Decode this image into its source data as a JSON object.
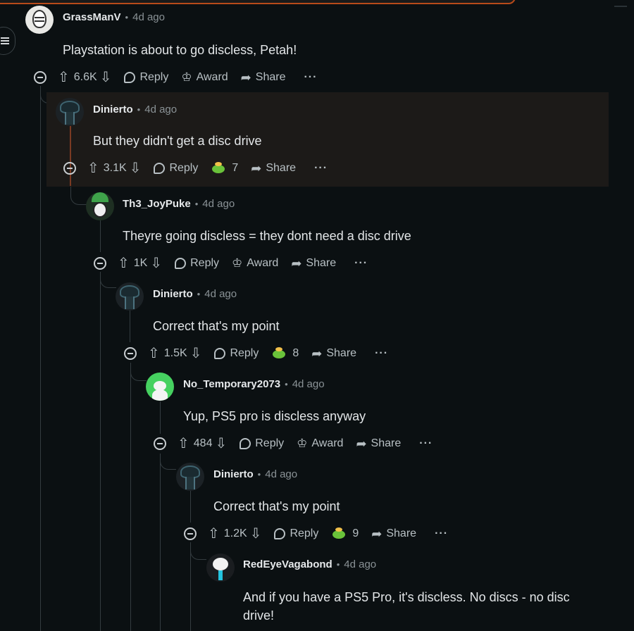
{
  "comments": [
    {
      "user": "GrassManV",
      "time": "4d ago",
      "text": "Playstation is about to go discless, Petah!",
      "votes": "6.6K",
      "reply": "Reply",
      "award": "Award",
      "share": "Share",
      "more": "···"
    },
    {
      "user": "Dinierto",
      "time": "4d ago",
      "text": "But they didn't get a disc drive",
      "votes": "3.1K",
      "reply": "Reply",
      "award_count": "7",
      "share": "Share",
      "more": "···"
    },
    {
      "user": "Th3_JoyPuke",
      "time": "4d ago",
      "text": "Theyre going discless = they dont need a disc drive",
      "votes": "1K",
      "reply": "Reply",
      "award": "Award",
      "share": "Share",
      "more": "···"
    },
    {
      "user": "Dinierto",
      "time": "4d ago",
      "text": "Correct that's my point",
      "votes": "1.5K",
      "reply": "Reply",
      "award_count": "8",
      "share": "Share",
      "more": "···"
    },
    {
      "user": "No_Temporary2073",
      "time": "4d ago",
      "text": "Yup, PS5 pro is discless anyway",
      "votes": "484",
      "reply": "Reply",
      "award": "Award",
      "share": "Share",
      "more": "···"
    },
    {
      "user": "Dinierto",
      "time": "4d ago",
      "text": "Correct that's my point",
      "votes": "1.2K",
      "reply": "Reply",
      "award_count": "9",
      "share": "Share",
      "more": "···"
    },
    {
      "user": "RedEyeVagabond",
      "time": "4d ago",
      "text_line1": "And if you have a PS5 Pro, it's discless. No discs - no disc",
      "text_line2": "drive!"
    }
  ],
  "icons": {
    "collapse": "collapse-icon",
    "upvote": "upvote-icon",
    "downvote": "downvote-icon",
    "reply": "reply-icon",
    "award": "award-icon",
    "share": "share-icon",
    "menu": "menu-icon"
  },
  "colors": {
    "background": "#0b1012",
    "highlight_bg": "#1c1a18",
    "highlight_line": "#7a3a22",
    "award_frog": "#6ac23a"
  }
}
